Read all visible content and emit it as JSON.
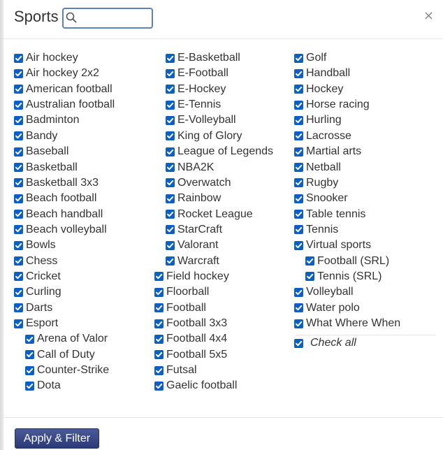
{
  "header": {
    "title": "Sports",
    "search_value": "",
    "close_glyph": "×"
  },
  "columns": [
    [
      {
        "label": "Air hockey",
        "checked": true,
        "indent": 0
      },
      {
        "label": "Air hockey 2x2",
        "checked": true,
        "indent": 0
      },
      {
        "label": "American football",
        "checked": true,
        "indent": 0
      },
      {
        "label": "Australian football",
        "checked": true,
        "indent": 0
      },
      {
        "label": "Badminton",
        "checked": true,
        "indent": 0
      },
      {
        "label": "Bandy",
        "checked": true,
        "indent": 0
      },
      {
        "label": "Baseball",
        "checked": true,
        "indent": 0
      },
      {
        "label": "Basketball",
        "checked": true,
        "indent": 0
      },
      {
        "label": "Basketball 3x3",
        "checked": true,
        "indent": 0
      },
      {
        "label": "Beach football",
        "checked": true,
        "indent": 0
      },
      {
        "label": "Beach handball",
        "checked": true,
        "indent": 0
      },
      {
        "label": "Beach volleyball",
        "checked": true,
        "indent": 0
      },
      {
        "label": "Bowls",
        "checked": true,
        "indent": 0
      },
      {
        "label": "Chess",
        "checked": true,
        "indent": 0
      },
      {
        "label": "Cricket",
        "checked": true,
        "indent": 0
      },
      {
        "label": "Curling",
        "checked": true,
        "indent": 0
      },
      {
        "label": "Darts",
        "checked": true,
        "indent": 0
      },
      {
        "label": "Esport",
        "checked": true,
        "indent": 0
      },
      {
        "label": "Arena of Valor",
        "checked": true,
        "indent": 1
      },
      {
        "label": "Call of Duty",
        "checked": true,
        "indent": 1
      },
      {
        "label": "Counter-Strike",
        "checked": true,
        "indent": 1
      },
      {
        "label": "Dota",
        "checked": true,
        "indent": 1
      }
    ],
    [
      {
        "label": "E-Basketball",
        "checked": true,
        "indent": 1
      },
      {
        "label": "E-Football",
        "checked": true,
        "indent": 1
      },
      {
        "label": "E-Hockey",
        "checked": true,
        "indent": 1
      },
      {
        "label": "E-Tennis",
        "checked": true,
        "indent": 1
      },
      {
        "label": "E-Volleyball",
        "checked": true,
        "indent": 1
      },
      {
        "label": "King of Glory",
        "checked": true,
        "indent": 1
      },
      {
        "label": "League of Legends",
        "checked": true,
        "indent": 1
      },
      {
        "label": "NBA2K",
        "checked": true,
        "indent": 1
      },
      {
        "label": "Overwatch",
        "checked": true,
        "indent": 1
      },
      {
        "label": "Rainbow",
        "checked": true,
        "indent": 1
      },
      {
        "label": "Rocket League",
        "checked": true,
        "indent": 1
      },
      {
        "label": "StarCraft",
        "checked": true,
        "indent": 1
      },
      {
        "label": "Valorant",
        "checked": true,
        "indent": 1
      },
      {
        "label": "Warcraft",
        "checked": true,
        "indent": 1
      },
      {
        "label": "Field hockey",
        "checked": true,
        "indent": 0
      },
      {
        "label": "Floorball",
        "checked": true,
        "indent": 0
      },
      {
        "label": "Football",
        "checked": true,
        "indent": 0
      },
      {
        "label": "Football 3x3",
        "checked": true,
        "indent": 0
      },
      {
        "label": "Football 4x4",
        "checked": true,
        "indent": 0
      },
      {
        "label": "Football 5x5",
        "checked": true,
        "indent": 0
      },
      {
        "label": "Futsal",
        "checked": true,
        "indent": 0
      },
      {
        "label": "Gaelic football",
        "checked": true,
        "indent": 0
      }
    ],
    [
      {
        "label": "Golf",
        "checked": true,
        "indent": 0
      },
      {
        "label": "Handball",
        "checked": true,
        "indent": 0
      },
      {
        "label": "Hockey",
        "checked": true,
        "indent": 0
      },
      {
        "label": "Horse racing",
        "checked": true,
        "indent": 0
      },
      {
        "label": "Hurling",
        "checked": true,
        "indent": 0
      },
      {
        "label": "Lacrosse",
        "checked": true,
        "indent": 0
      },
      {
        "label": "Martial arts",
        "checked": true,
        "indent": 0
      },
      {
        "label": "Netball",
        "checked": true,
        "indent": 0
      },
      {
        "label": "Rugby",
        "checked": true,
        "indent": 0
      },
      {
        "label": "Snooker",
        "checked": true,
        "indent": 0
      },
      {
        "label": "Table tennis",
        "checked": true,
        "indent": 0
      },
      {
        "label": "Tennis",
        "checked": true,
        "indent": 0
      },
      {
        "label": "Virtual sports",
        "checked": true,
        "indent": 0
      },
      {
        "label": "Football (SRL)",
        "checked": true,
        "indent": 1
      },
      {
        "label": "Tennis (SRL)",
        "checked": true,
        "indent": 1
      },
      {
        "label": "Volleyball",
        "checked": true,
        "indent": 0
      },
      {
        "label": "Water polo",
        "checked": true,
        "indent": 0
      },
      {
        "label": "What Where When",
        "checked": true,
        "indent": 0
      }
    ]
  ],
  "check_all": {
    "label": "Check all",
    "checked": true
  },
  "footer": {
    "apply_label": "Apply & Filter"
  },
  "colors": {
    "checkbox": "#0b5fc5",
    "apply_button": "#33427e",
    "search_border": "#5a82b8"
  }
}
